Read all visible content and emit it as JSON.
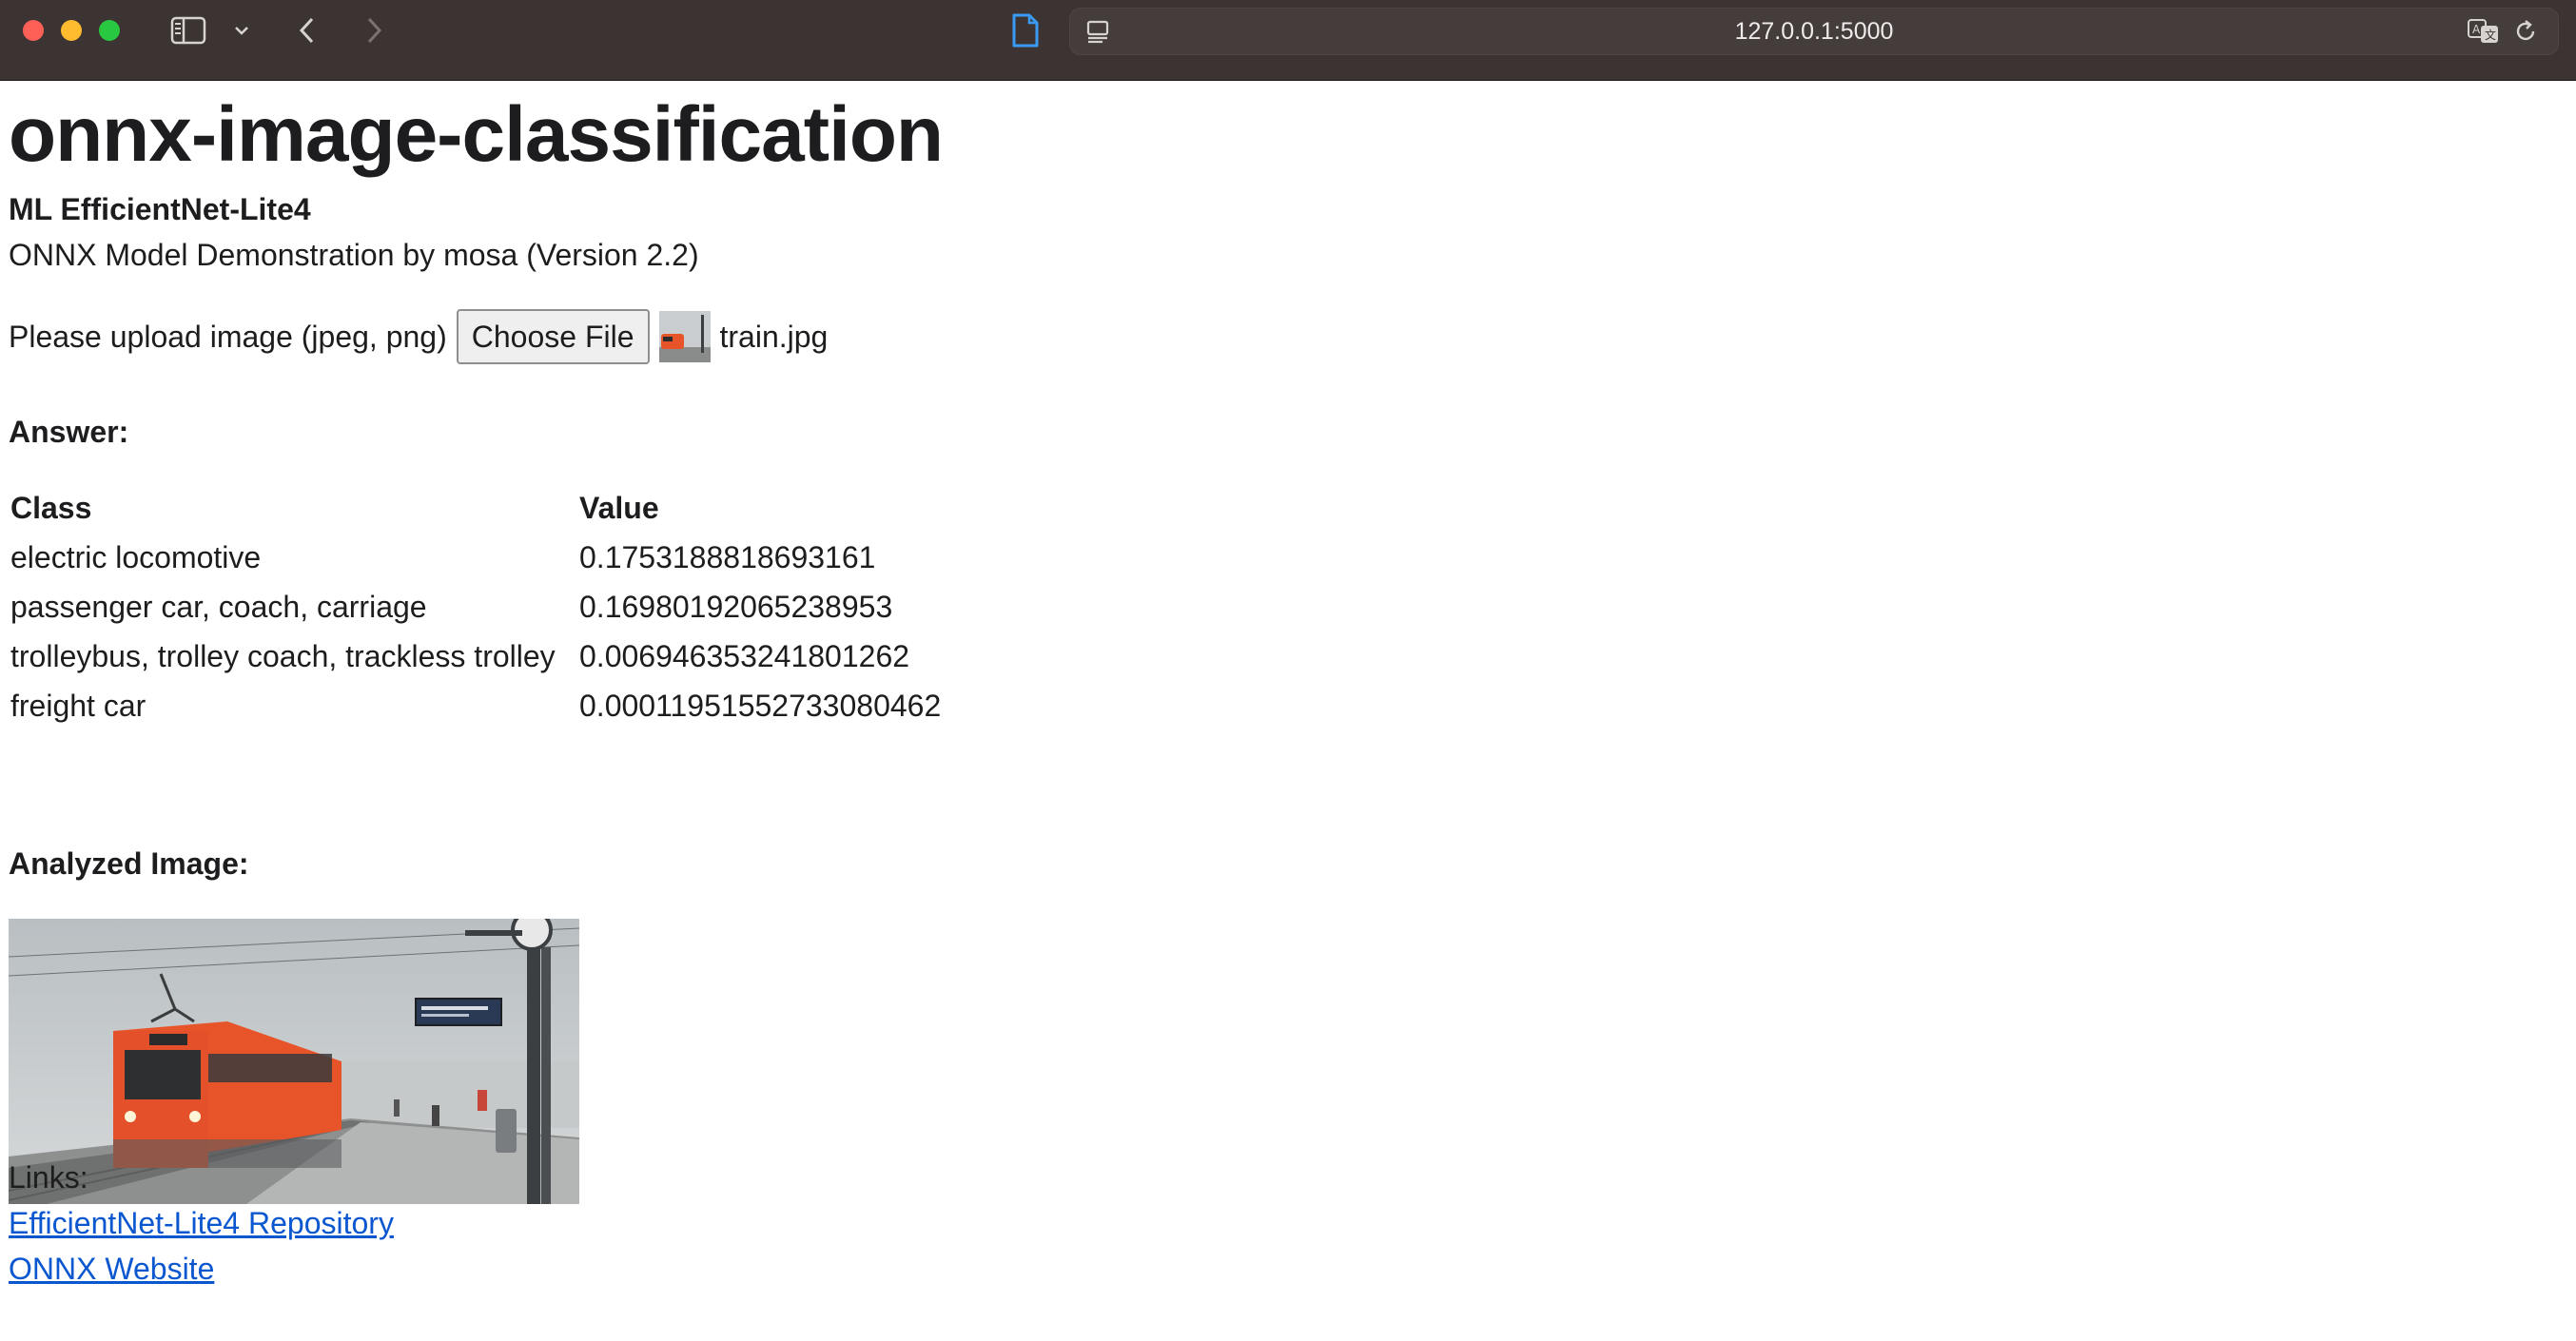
{
  "browser": {
    "url": "127.0.0.1:5000"
  },
  "page": {
    "title": "onnx-image-classification",
    "model_name": "ML EfficientNet-Lite4",
    "description": "ONNX Model Demonstration by mosa (Version 2.2)",
    "upload": {
      "label": "Please upload image (jpeg, png)",
      "button_label": "Choose File",
      "file_name": "train.jpg"
    },
    "answer_label": "Answer:",
    "results": {
      "headers": [
        "Class",
        "Value"
      ],
      "rows": [
        {
          "class": "electric locomotive",
          "value": "0.1753188818693161"
        },
        {
          "class": "passenger car, coach, carriage",
          "value": "0.16980192065238953"
        },
        {
          "class": "trolleybus, trolley coach, trackless trolley",
          "value": "0.006946353241801262"
        },
        {
          "class": "freight car",
          "value": "0.00011951552733080462"
        }
      ]
    },
    "analyzed_label": "Analyzed Image:",
    "links_label": "Links:",
    "links": [
      {
        "label": "EfficientNet-Lite4 Repository"
      },
      {
        "label": "ONNX Website"
      }
    ]
  },
  "colors": {
    "chrome_bg": "#3c3433",
    "link": "#0b57d0",
    "train_orange": "#e8542a"
  }
}
